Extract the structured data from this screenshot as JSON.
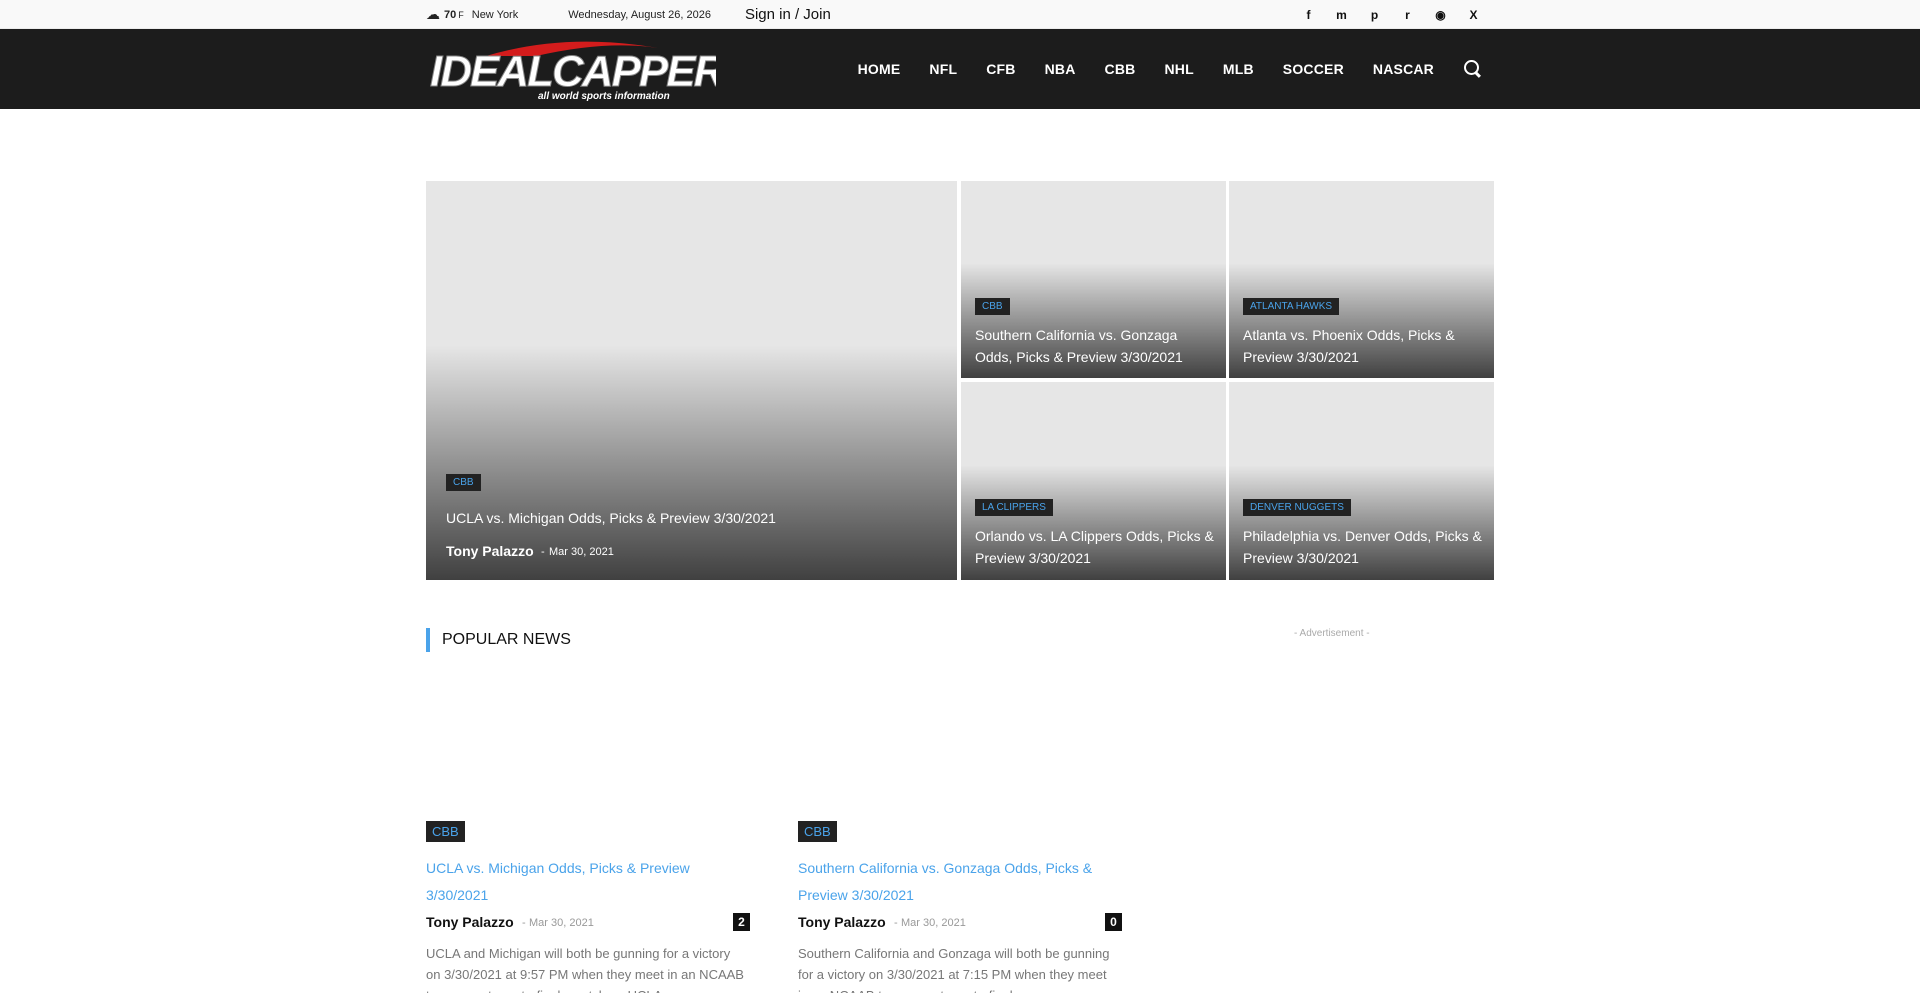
{
  "topbar": {
    "temperature": "70",
    "unit": "F",
    "city": "New York",
    "date": "Wednesday, August 26, 2026",
    "signin": "Sign in / Join",
    "socials": [
      "f",
      "m",
      "p",
      "r",
      "rss",
      "X"
    ]
  },
  "header": {
    "logo_main": "IDEALCAPPER",
    "logo_tagline": "all world sports information",
    "nav": [
      "HOME",
      "NFL",
      "CFB",
      "NBA",
      "CBB",
      "NHL",
      "MLB",
      "SOCCER",
      "NASCAR"
    ]
  },
  "featured": {
    "big": {
      "category": "CBB",
      "title": "UCLA vs. Michigan Odds, Picks & Preview 3/30/2021",
      "author": "Tony Palazzo",
      "sep": "-",
      "date": "Mar 30, 2021"
    },
    "small": [
      {
        "category": "CBB",
        "title": "Southern California vs. Gonzaga Odds, Picks & Preview 3/30/2021"
      },
      {
        "category": "ATLANTA HAWKS",
        "title": "Atlanta vs. Phoenix Odds, Picks & Preview 3/30/2021"
      },
      {
        "category": "LA CLIPPERS",
        "title": "Orlando vs. LA Clippers Odds, Picks & Preview 3/30/2021"
      },
      {
        "category": "DENVER NUGGETS",
        "title": "Philadelphia vs. Denver Odds, Picks & Preview 3/30/2021"
      }
    ]
  },
  "popular": {
    "title": "POPULAR NEWS",
    "advertisement": "- Advertisement -",
    "cards": [
      {
        "category": "CBB",
        "title": "UCLA vs. Michigan Odds, Picks & Preview 3/30/2021",
        "author": "Tony Palazzo",
        "sep": "-",
        "date": "Mar 30, 2021",
        "comments": "2",
        "excerpt": "UCLA and Michigan will both be gunning for a victory on 3/30/2021 at 9:57 PM when they meet in an NCAAB tournament quarterfinals matchup. UCLA"
      },
      {
        "category": "CBB",
        "title": "Southern California vs. Gonzaga Odds, Picks & Preview 3/30/2021",
        "author": "Tony Palazzo",
        "sep": "-",
        "date": "Mar 30, 2021",
        "comments": "0",
        "excerpt": "Southern California and Gonzaga will both be gunning for a victory on 3/30/2021 at 7:15 PM when they meet in an NCAAB tournament quarterfinals"
      }
    ]
  }
}
